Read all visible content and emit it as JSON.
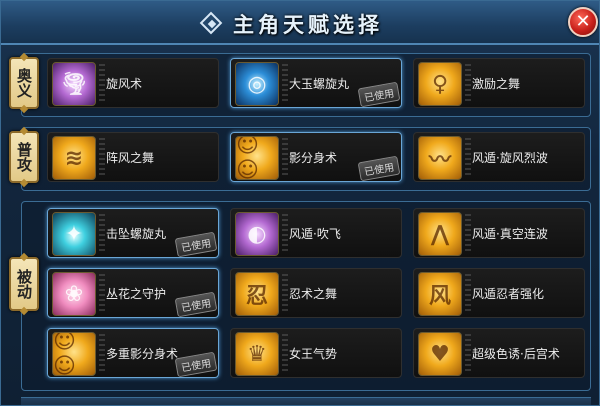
{
  "window": {
    "title": "主角天赋选择",
    "close_label": "✕"
  },
  "sections": [
    {
      "label": "奥义",
      "skills": [
        {
          "name": "旋风术",
          "used": false,
          "icon": "tornado-icon",
          "color": "purple"
        },
        {
          "name": "大玉螺旋丸",
          "used": true,
          "icon": "rasengan-icon",
          "color": "blue",
          "selected": true
        },
        {
          "name": "激励之舞",
          "used": false,
          "icon": "dancer-icon",
          "color": "gold"
        }
      ]
    },
    {
      "label": "普攻",
      "skills": [
        {
          "name": "阵风之舞",
          "used": false,
          "icon": "wind-swirl-icon",
          "color": "gold"
        },
        {
          "name": "影分身术",
          "used": true,
          "icon": "shadow-clone-icon",
          "color": "gold",
          "selected": true
        },
        {
          "name": "风遁·旋风烈波",
          "used": false,
          "icon": "wind-wave-icon",
          "color": "gold"
        }
      ]
    },
    {
      "label": "被动",
      "skills": [
        {
          "name": "击坠螺旋丸",
          "used": true,
          "icon": "spiral-orb-icon",
          "color": "cyan",
          "selected": true
        },
        {
          "name": "风遁·吹飞",
          "used": false,
          "icon": "fan-icon",
          "color": "purple"
        },
        {
          "name": "风遁·真空连波",
          "used": false,
          "icon": "vacuum-wave-icon",
          "color": "gold"
        },
        {
          "name": "丛花之守护",
          "used": true,
          "icon": "flower-guard-icon",
          "color": "pink",
          "selected": true
        },
        {
          "name": "忍术之舞",
          "used": false,
          "icon": "scroll-icon",
          "color": "gold",
          "glyph": "忍"
        },
        {
          "name": "风遁忍者强化",
          "used": false,
          "icon": "wind-kanji-icon",
          "color": "gold",
          "glyph": "风"
        },
        {
          "name": "多重影分身术",
          "used": true,
          "icon": "multi-clone-icon",
          "color": "gold",
          "selected": true
        },
        {
          "name": "女王气势",
          "used": false,
          "icon": "queen-icon",
          "color": "gold"
        },
        {
          "name": "超级色诱·后宫术",
          "used": false,
          "icon": "harem-icon",
          "color": "gold"
        }
      ]
    }
  ],
  "used_badge": "已使用"
}
